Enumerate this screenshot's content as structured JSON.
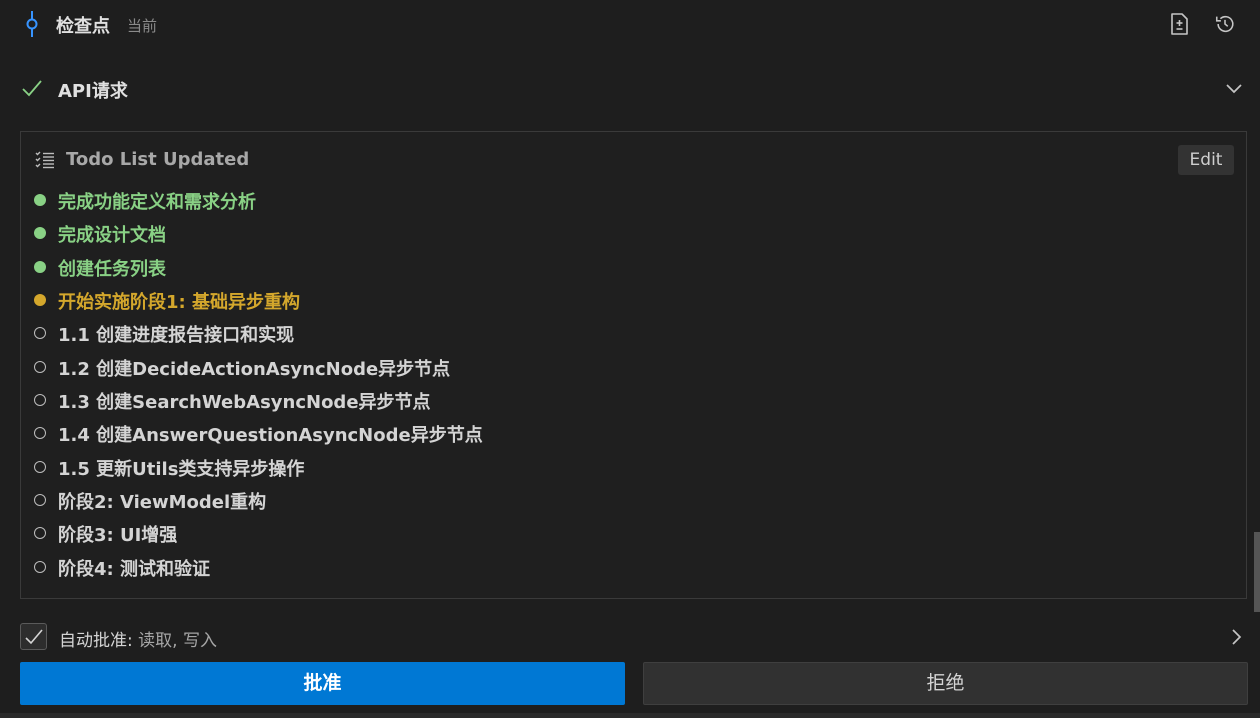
{
  "checkpoint": {
    "title": "检查点",
    "subtitle": "当前"
  },
  "api_request": {
    "title": "API请求"
  },
  "todo": {
    "title": "Todo List Updated",
    "edit_label": "Edit",
    "items": [
      {
        "text": "完成功能定义和需求分析",
        "status": "done"
      },
      {
        "text": "完成设计文档",
        "status": "done"
      },
      {
        "text": "创建任务列表",
        "status": "done"
      },
      {
        "text": "开始实施阶段1: 基础异步重构",
        "status": "active"
      },
      {
        "text": "1.1 创建进度报告接口和实现",
        "status": "pending"
      },
      {
        "text": "1.2 创建DecideActionAsyncNode异步节点",
        "status": "pending"
      },
      {
        "text": "1.3 创建SearchWebAsyncNode异步节点",
        "status": "pending"
      },
      {
        "text": "1.4 创建AnswerQuestionAsyncNode异步节点",
        "status": "pending"
      },
      {
        "text": "1.5 更新Utils类支持异步操作",
        "status": "pending"
      },
      {
        "text": "阶段2: ViewModel重构",
        "status": "pending"
      },
      {
        "text": "阶段3: UI增强",
        "status": "pending"
      },
      {
        "text": "阶段4: 测试和验证",
        "status": "pending"
      }
    ]
  },
  "auto_approve": {
    "label": "自动批准:",
    "scope": " 读取, 写入",
    "checked": true
  },
  "actions": {
    "approve_label": "批准",
    "reject_label": "拒绝"
  },
  "colors": {
    "done": "#89d185",
    "active": "#d4a72c",
    "primary": "#0078d4"
  }
}
